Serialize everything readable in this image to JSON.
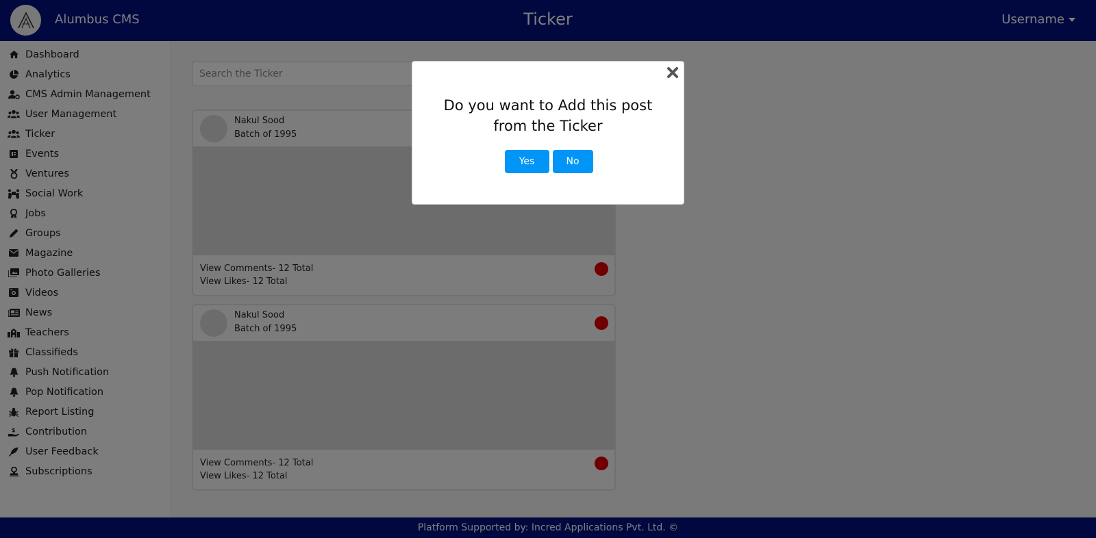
{
  "header": {
    "app_name": "Alumbus CMS",
    "page_title": "Ticker",
    "user_label": "Username"
  },
  "sidebar": {
    "items": [
      {
        "label": "Dashboard",
        "icon": "home-icon"
      },
      {
        "label": "Analytics",
        "icon": "pie-chart-icon"
      },
      {
        "label": "CMS Admin Management",
        "icon": "user-cog-icon"
      },
      {
        "label": "User Management",
        "icon": "users-icon"
      },
      {
        "label": "Ticker",
        "icon": "users-icon"
      },
      {
        "label": "Events",
        "icon": "calendar-icon"
      },
      {
        "label": "Ventures",
        "icon": "medal-icon"
      },
      {
        "label": "Social Work",
        "icon": "people-carry-icon"
      },
      {
        "label": "Jobs",
        "icon": "award-icon"
      },
      {
        "label": "Groups",
        "icon": "pen-icon"
      },
      {
        "label": "Magazine",
        "icon": "envelope-icon"
      },
      {
        "label": "Photo Galleries",
        "icon": "images-icon"
      },
      {
        "label": "Videos",
        "icon": "video-icon"
      },
      {
        "label": "News",
        "icon": "newspaper-icon"
      },
      {
        "label": "Teachers",
        "icon": "school-icon"
      },
      {
        "label": "Classifieds",
        "icon": "gift-icon"
      },
      {
        "label": "Push Notification",
        "icon": "bell-icon"
      },
      {
        "label": "Pop Notification",
        "icon": "bell-icon"
      },
      {
        "label": "Report Listing",
        "icon": "bug-icon"
      },
      {
        "label": "Contribution",
        "icon": "hand-holding-dollar-icon"
      },
      {
        "label": "User Feedback",
        "icon": "feather-icon"
      },
      {
        "label": "Subscriptions",
        "icon": "stamp-icon"
      }
    ]
  },
  "search": {
    "placeholder": "Search the Ticker"
  },
  "posts": [
    {
      "author": "Nakul Sood",
      "batch": "Batch of 1995",
      "comments": "View Comments- 12 Total",
      "likes": "View Likes- 12 Total"
    },
    {
      "author": "Nakul Sood",
      "batch": "Batch of 1995",
      "comments": "View Comments- 12 Total",
      "likes": "View Likes- 12 Total"
    }
  ],
  "modal": {
    "message": "Do you want to Add this post from the Ticker",
    "yes_label": "Yes",
    "no_label": "No"
  },
  "footer": {
    "text": "Platform Supported by: Incred Applications Pvt. Ltd. ©"
  },
  "colors": {
    "header_bg": "#01117e",
    "button_primary": "#0095f6",
    "status_dot": "#e00000"
  }
}
